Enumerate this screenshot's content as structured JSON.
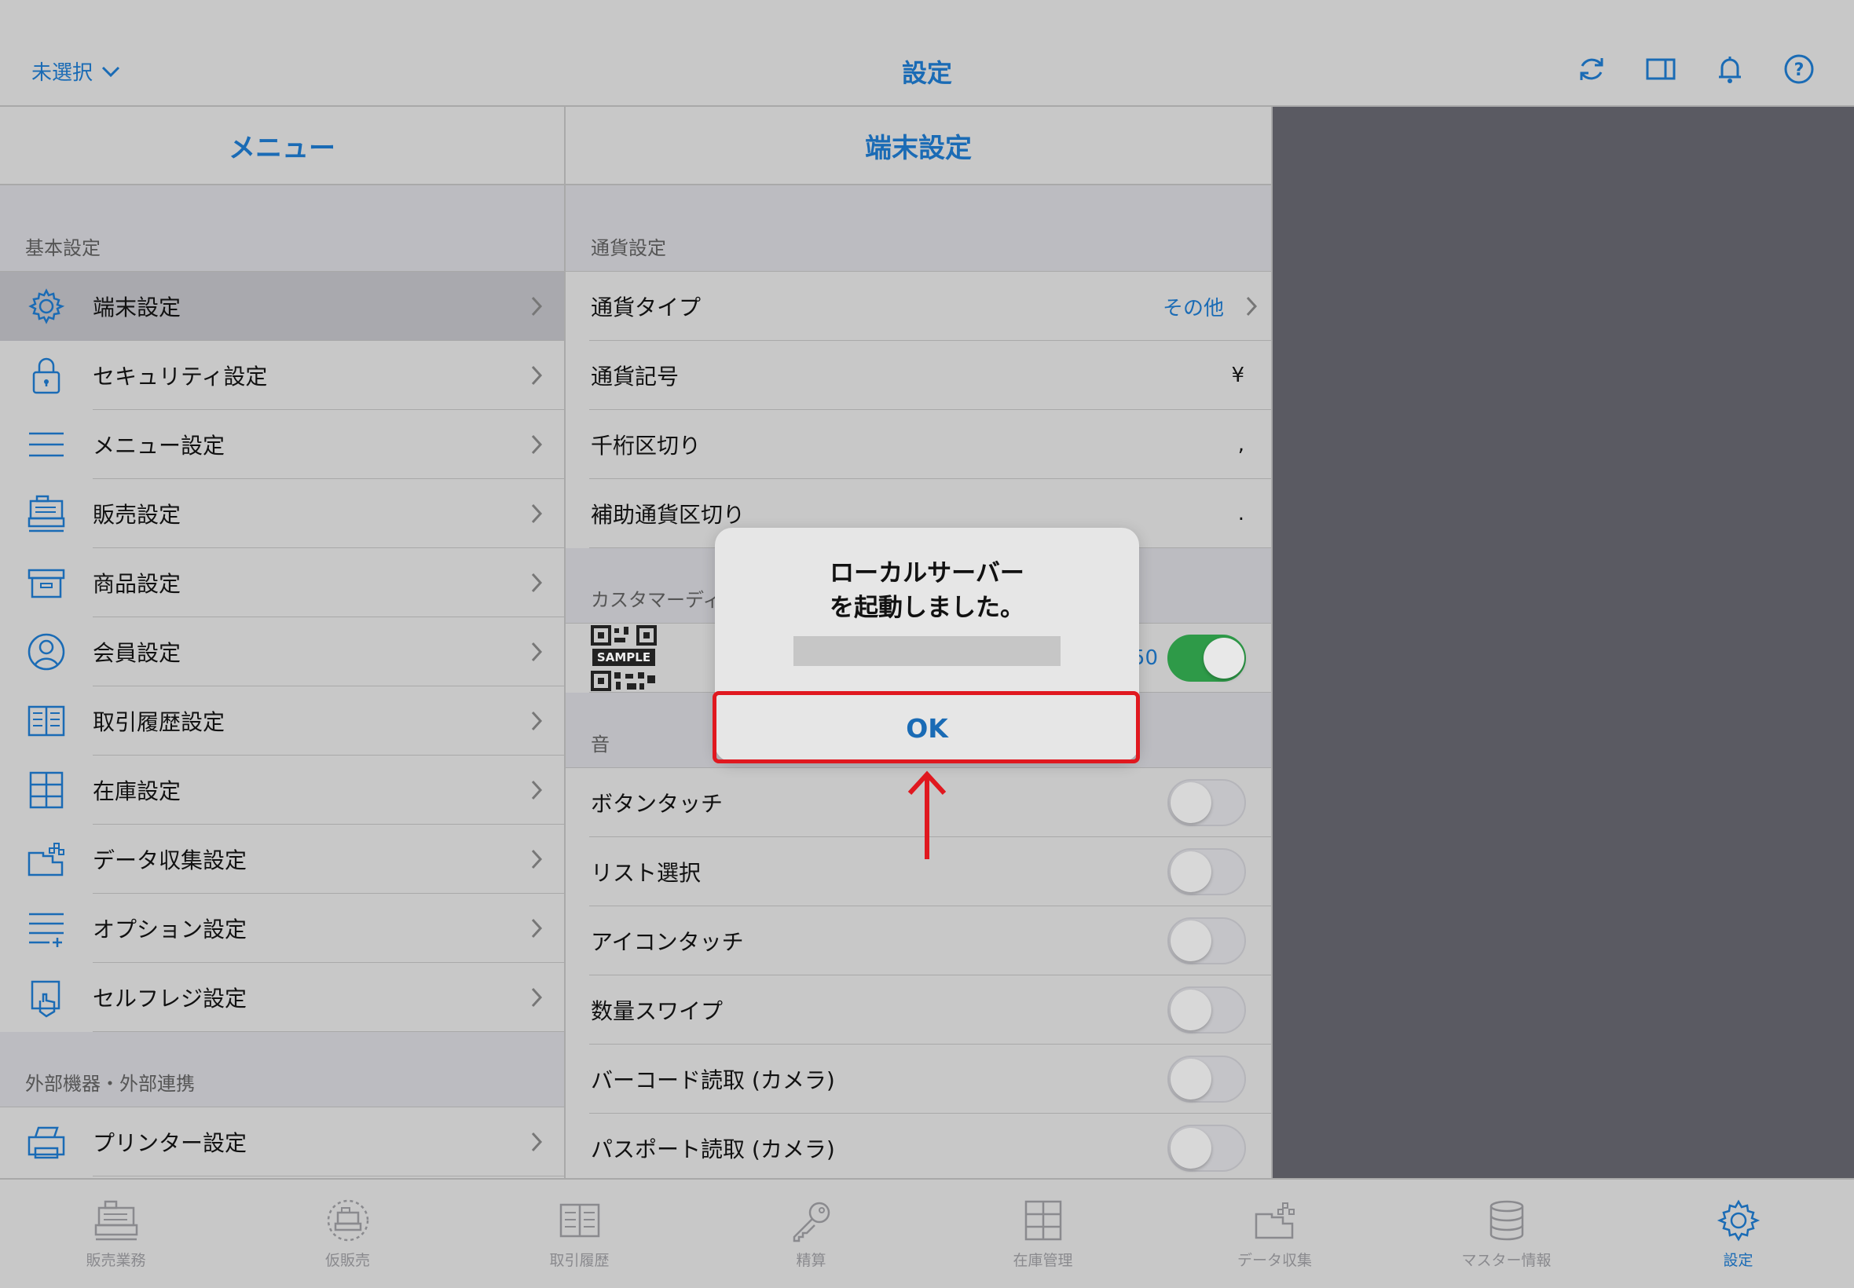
{
  "topbar": {
    "store_select": "未選択",
    "title": "設定",
    "icons": [
      "sync-icon",
      "split-view-icon",
      "bell-icon",
      "help-icon"
    ]
  },
  "menu": {
    "header": "メニュー",
    "section1": "基本設定",
    "items": [
      {
        "label": "端末設定",
        "icon": "gear-icon",
        "selected": true
      },
      {
        "label": "セキュリティ設定",
        "icon": "lock-icon"
      },
      {
        "label": "メニュー設定",
        "icon": "hamburger-icon"
      },
      {
        "label": "販売設定",
        "icon": "register-icon"
      },
      {
        "label": "商品設定",
        "icon": "box-icon"
      },
      {
        "label": "会員設定",
        "icon": "user-icon"
      },
      {
        "label": "取引履歴設定",
        "icon": "book-icon"
      },
      {
        "label": "在庫設定",
        "icon": "shelf-icon"
      },
      {
        "label": "データ収集設定",
        "icon": "data-collect-icon"
      },
      {
        "label": "オプション設定",
        "icon": "options-list-icon"
      },
      {
        "label": "セルフレジ設定",
        "icon": "self-register-icon"
      }
    ],
    "section2": "外部機器・外部連携",
    "items2": [
      {
        "label": "プリンター設定",
        "icon": "printer-icon"
      }
    ]
  },
  "detail": {
    "header": "端末設定",
    "currency_section": "通貨設定",
    "currency_type_label": "通貨タイプ",
    "currency_type_value": "その他",
    "currency_symbol_label": "通貨記号",
    "currency_symbol_value": "¥",
    "thousands_label": "千桁区切り",
    "thousands_value": ",",
    "decimal_label": "補助通貨区切り",
    "decimal_value": ".",
    "customer_section": "カスタマーディ",
    "qr_sample": "SAMPLE",
    "qr_count": "50",
    "sound_section": "音",
    "sound_items": [
      {
        "label": "ボタンタッチ",
        "on": false
      },
      {
        "label": "リスト選択",
        "on": false
      },
      {
        "label": "アイコンタッチ",
        "on": false
      },
      {
        "label": "数量スワイプ",
        "on": false
      },
      {
        "label": "バーコード読取 (カメラ)",
        "on": false
      },
      {
        "label": "パスポート読取 (カメラ)",
        "on": false
      }
    ]
  },
  "dialog": {
    "title_line1": "ローカルサーバー",
    "title_line2": "を起動しました。",
    "ok_label": "OK"
  },
  "tabbar": {
    "tabs": [
      {
        "label": "販売業務",
        "icon": "register-tab-icon"
      },
      {
        "label": "仮販売",
        "icon": "temp-sale-tab-icon"
      },
      {
        "label": "取引履歴",
        "icon": "history-tab-icon"
      },
      {
        "label": "精算",
        "icon": "key-tab-icon"
      },
      {
        "label": "在庫管理",
        "icon": "inventory-tab-icon"
      },
      {
        "label": "データ収集",
        "icon": "data-tab-icon"
      },
      {
        "label": "マスター情報",
        "icon": "database-tab-icon"
      },
      {
        "label": "設定",
        "icon": "settings-tab-icon",
        "active": true
      }
    ]
  },
  "colors": {
    "accent": "#1a6bb5",
    "highlight": "#e0181f",
    "toggle_on": "#2e9a48"
  }
}
